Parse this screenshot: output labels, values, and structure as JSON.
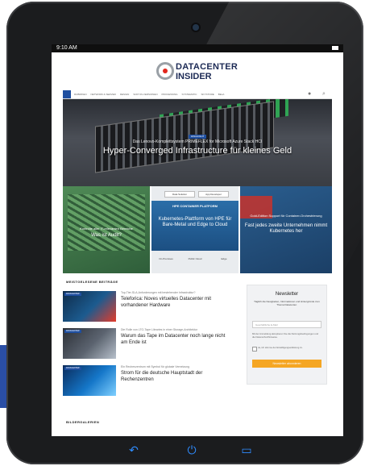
{
  "statusbar": {
    "time": "9:10 AM"
  },
  "site": {
    "logo": {
      "line1": "DATACENTER",
      "line2": "INSIDER"
    },
    "nav": {
      "items": [
        "RUBRIKEN",
        "NETWORK & SERVER",
        "DESIGN",
        "SOFT.IN-VERSIONEN",
        "PROCESSING",
        "SYSTEMATIC",
        "SKYSTORE",
        "BELA"
      ]
    },
    "hero": {
      "badge": "HIGHLIGHT",
      "kicker": "Das Lenovo-Komplettsystem PRIMEFLEX for Microsoft Azure Stack HCI",
      "title": "Hyper-Converged Infrastructure für kleines Geld"
    },
    "tiles": [
      {
        "kicker": "Kontrolle aller IT-relevanten Bereiche",
        "title": "Was ist Audit?"
      },
      {
        "btn1": "Data Solution",
        "btn2": "App Developer",
        "label": "HPE CONTAINER PLATFORM",
        "title": "Kubernetes-Plattform von HPE für Bare-Metal und Edge to Cloud",
        "icons": [
          "On-Premises",
          "Public Cloud",
          "Edge"
        ]
      },
      {
        "kicker": "Gold-Edition Support für Container-Orchestrierung",
        "title": "Fast jedes zweite Unternehmen nimmt Kubernetes her"
      }
    ],
    "sections": {
      "most_read": "MEISTGELESENE BEITRÄGE",
      "galleries": "BILDERGALERIEN"
    },
    "articles": [
      {
        "tag": "DATACENTER",
        "kicker": "Top-Tier-SLA-Anforderungen mit bestehender Infrastruktur?",
        "headline": "Teleforica: Noves virtuelles Datacenter mit vorhandener Hardware"
      },
      {
        "tag": "DATACENTER",
        "kicker": "Die Rolle von LTO-Tape Libraries in einer Storage-Architektur",
        "headline": "Warum das Tape im Datacenter noch lange nicht am Ende ist"
      },
      {
        "tag": "DATACENTER",
        "kicker": "Ein Rechenzentrum mit Symbol für globale Vernetzung",
        "headline": "Strom für die deutsche Hauptstadt der Rechenzentren"
      }
    ],
    "newsletter": {
      "title": "Newsletter",
      "description": "Täglich die Neuigkeiten, Informationen und Hintergründe zum Thema Datacenter.",
      "input_placeholder": "Geschäftliche E-Mail",
      "privacy": "Mit der Anmeldung akzeptieren Sie die Nutzungsbedingungen und die Datenschutzhinweise.",
      "checkbox_label": "Ja, ich stimme der Einwilligungserklärung zu.",
      "button": "Newsletter abonnieren"
    }
  },
  "colors": {
    "accent": "#1f4fa0",
    "newsletter_button": "#f5a623",
    "logo_red": "#e2261c"
  },
  "device_nav": {
    "back_icon": "back-arrow-icon",
    "power_icon": "power-icon",
    "recents_icon": "recents-icon"
  }
}
